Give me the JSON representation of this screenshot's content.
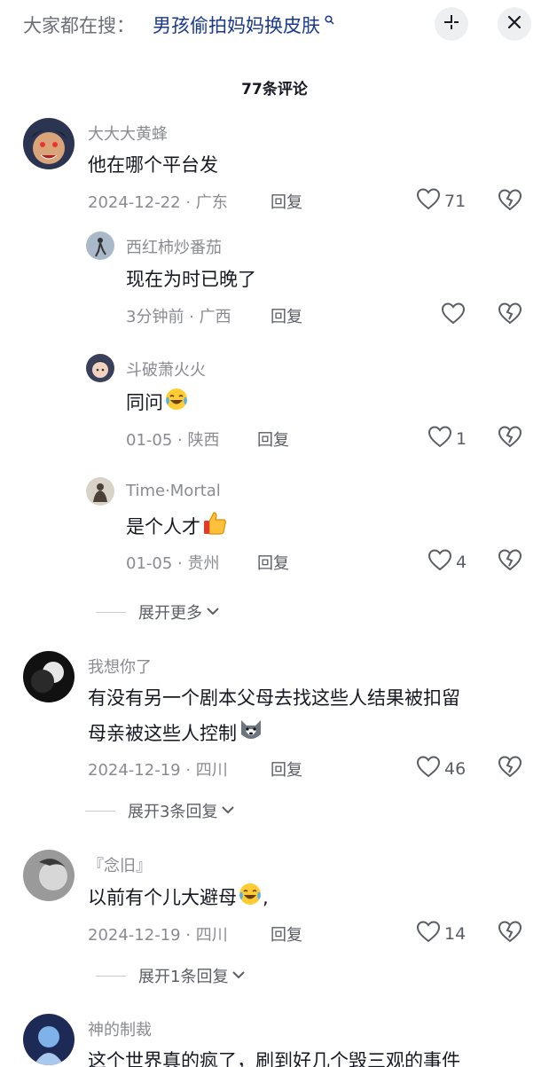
{
  "header": {
    "search_prefix": "大家都在搜：",
    "search_term": "男孩偷拍妈妈换皮肤",
    "search_icon": "search-icon",
    "collapse_icon": "collapse-icon",
    "close_icon": "close-icon"
  },
  "comment_count": "77条评论",
  "comments": [
    {
      "username": "大大大黄蜂",
      "text": "他在哪个平台发",
      "date_location": "2024-12-22 · 广东",
      "reply": "回复",
      "likes": "71",
      "replies": [
        {
          "username": "西红柿炒番茄",
          "text": "现在为时已晚了",
          "date_location": "3分钟前 · 广西",
          "reply": "回复",
          "likes": ""
        },
        {
          "username": "斗破萧火火",
          "text": "同问",
          "emoji": "laughing-tears-emoji",
          "date_location": "01-05 · 陕西",
          "reply": "回复",
          "likes": "1"
        },
        {
          "username": "Time·Mortal",
          "text": "是个人才",
          "emoji": "thumbs-up-emoji",
          "date_location": "01-05 · 贵州",
          "reply": "回复",
          "likes": "4"
        }
      ],
      "expand_label": "展开更多"
    },
    {
      "username": "我想你了",
      "text_line1": "有没有另一个剧本父母去找这些人结果被扣留",
      "text_line2": "母亲被这些人控制",
      "emoji": "husky-emoji",
      "date_location": "2024-12-19 · 四川",
      "reply": "回复",
      "likes": "46",
      "expand_label": "展开3条回复"
    },
    {
      "username": "『念旧』",
      "text": "以前有个儿大避母",
      "text_suffix": ",",
      "emoji": "laughing-tears-emoji",
      "date_location": "2024-12-19 · 四川",
      "reply": "回复",
      "likes": "14",
      "expand_label": "展开1条回复"
    },
    {
      "username": "神的制裁",
      "text": "这个世界真的疯了，刷到好几个毁三观的事件"
    }
  ],
  "colors": {
    "link_blue": "#1a3a8e",
    "muted": "#8a8b91",
    "text": "#161823"
  }
}
